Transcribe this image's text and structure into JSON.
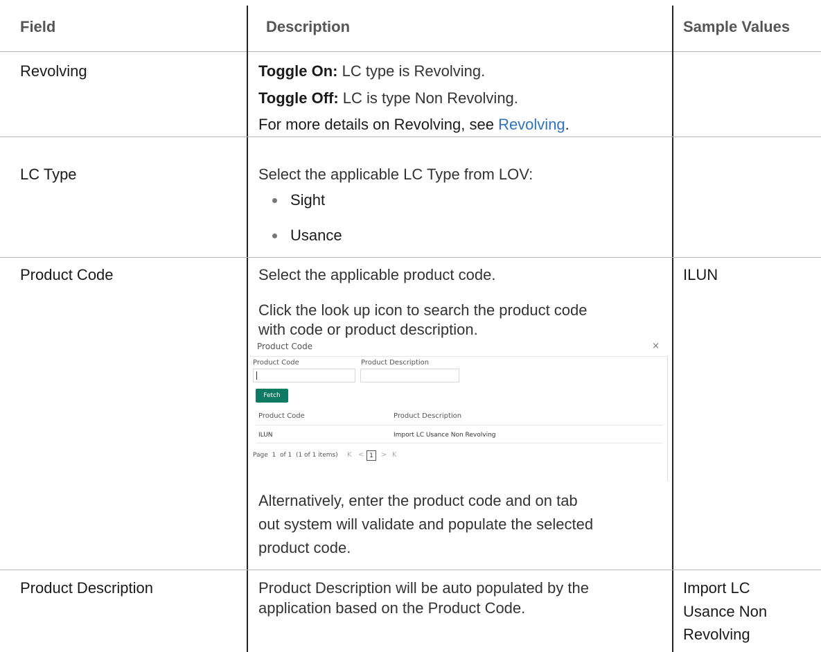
{
  "headers": {
    "field": "Field",
    "description": "Description",
    "sample": "Sample Values"
  },
  "rows": [
    {
      "field": "Revolving",
      "toggle_on_label": "Toggle On:",
      "toggle_on_text": " LC type is Revolving.",
      "toggle_off_label": "Toggle Off:",
      "toggle_off_text": " LC is type Non Revolving.",
      "more_prefix": "For more details on Revolving, see ",
      "more_link": "Revolving",
      "more_suffix": ".",
      "sample": ""
    },
    {
      "field": "LC Type",
      "intro": "Select the applicable LC Type from LOV:",
      "options": [
        "Sight",
        "Usance"
      ],
      "sample": ""
    },
    {
      "field": "Product Code",
      "line1": "Select the applicable product code.",
      "line2a": "Click the look up icon to search the product code",
      "line2b": "with code or product description.",
      "alt1": "Alternatively, enter the product code and on tab",
      "alt2": "out system will validate and populate the selected",
      "alt3": "product code.",
      "sample": "ILUN"
    },
    {
      "field": "Product Description",
      "desc1": "Product Description will be auto populated by the",
      "desc2": "application based on the Product Code.",
      "sample1": "Import LC",
      "sample2": "Usance Non",
      "sample3": "Revolving"
    }
  ],
  "dialog": {
    "title": "Product Code",
    "close": "×",
    "label_code": "Product Code",
    "label_desc": "Product Description",
    "fetch": "Fetch",
    "col_code": "Product Code",
    "col_desc": "Product Description",
    "row_code": "ILUN",
    "row_desc": "Import LC Usance Non Revolving",
    "page_info": "Page  1  of 1  (1 of 1 items)",
    "nav_first": "K",
    "nav_prev": "<",
    "page_current": "1",
    "nav_next": ">",
    "nav_last": "K"
  }
}
